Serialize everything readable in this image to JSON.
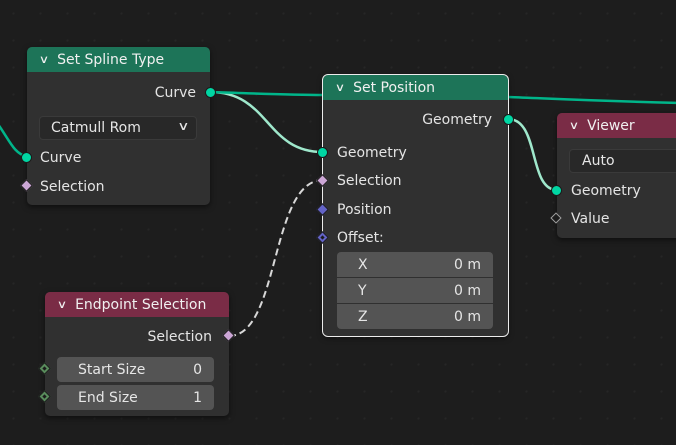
{
  "colors": {
    "geometry_socket": "#00d6a3",
    "boolean_socket": "#cca6d6",
    "vector_socket": "#6363c7",
    "integer_socket": "#598c5c",
    "geometry_node_header": "#1d7458",
    "input_node_header": "#7a2c46",
    "selected_wire": "#9fe8cc",
    "geometry_wire": "#00b58a",
    "background": "#1d1d1d"
  },
  "nodes": {
    "set_spline_type": {
      "title": "Set Spline Type",
      "output_curve": "Curve",
      "spline_type_value": "Catmull Rom",
      "input_curve": "Curve",
      "input_selection": "Selection"
    },
    "set_position": {
      "title": "Set Position",
      "output_geometry": "Geometry",
      "input_geometry": "Geometry",
      "input_selection": "Selection",
      "input_position": "Position",
      "input_offset": "Offset:",
      "offset": {
        "x_label": "X",
        "x_value": "0 m",
        "y_label": "Y",
        "y_value": "0 m",
        "z_label": "Z",
        "z_value": "0 m"
      }
    },
    "viewer": {
      "title": "Viewer",
      "domain_value": "Auto",
      "input_geometry": "Geometry",
      "input_value": "Value"
    },
    "endpoint_selection": {
      "title": "Endpoint Selection",
      "output_selection": "Selection",
      "start_size_label": "Start Size",
      "start_size_value": "0",
      "end_size_label": "End Size",
      "end_size_value": "1"
    }
  }
}
